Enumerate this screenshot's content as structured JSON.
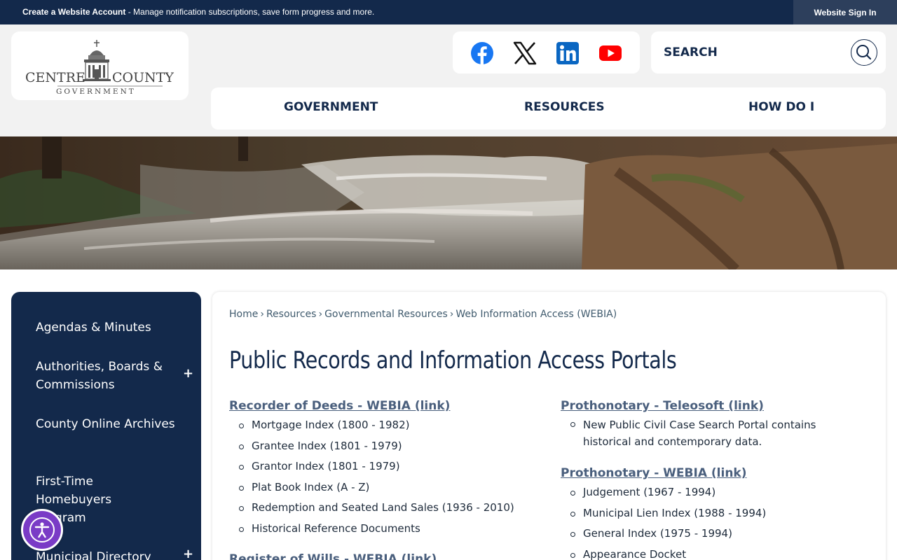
{
  "topbar": {
    "create_account": "Create a Website Account",
    "message": " - Manage notification subscriptions, save form progress and more.",
    "sign_in": "Website Sign In"
  },
  "logo": {
    "line1_left": "CENTRE",
    "line1_right": "COUNTY",
    "line2": "GOVERNMENT"
  },
  "social": [
    "facebook-icon",
    "x-icon",
    "linkedin-icon",
    "youtube-icon"
  ],
  "search": {
    "placeholder": "SEARCH"
  },
  "nav": {
    "government": "GOVERNMENT",
    "resources": "RESOURCES",
    "how_do_i": "HOW DO I"
  },
  "sidebar": {
    "items": [
      {
        "label": "Agendas & Minutes"
      },
      {
        "label": "Authorities, Boards & Commissions",
        "expandable": true
      },
      {
        "label": "County Online Archives"
      },
      {
        "label": "First-Time Homebuyers Program"
      },
      {
        "label": "Municipal Directory",
        "expandable": true
      }
    ],
    "plus": "+"
  },
  "breadcrumb": {
    "home": "Home",
    "resources": "Resources",
    "governmental": "Governmental Resources",
    "current": "Web Information Access (WEBIA)",
    "sep": "›"
  },
  "page_title": "Public Records and Information Access Portals",
  "left_col": {
    "recorder_heading": "Recorder of Deeds - WEBIA (link)",
    "recorder_items": [
      "Mortgage Index (1800 - 1982)",
      "Grantee Index (1801 - 1979)",
      "Grantor Index (1801 - 1979)",
      "Plat Book Index (A - Z)",
      "Redemption and Seated Land Sales (1936 - 2010)",
      "Historical Reference Documents"
    ],
    "register_heading": "Register of Wills - WEBIA (link)"
  },
  "right_col": {
    "teleosoft_heading": "Prothonotary - Teleosoft (link)",
    "teleosoft_items": [
      "New Public Civil Case Search Portal contains historical and contemporary data."
    ],
    "webia_heading": "Prothonotary - WEBIA (link)",
    "webia_items": [
      "Judgement (1967 - 1994)",
      "Municipal Lien Index (1988 - 1994)",
      "General Index (1975 - 1994)",
      "Appearance Docket"
    ]
  },
  "colors": {
    "navy": "#13294b",
    "link": "#4a5f7d",
    "accessibility": "#7a3bc6"
  }
}
